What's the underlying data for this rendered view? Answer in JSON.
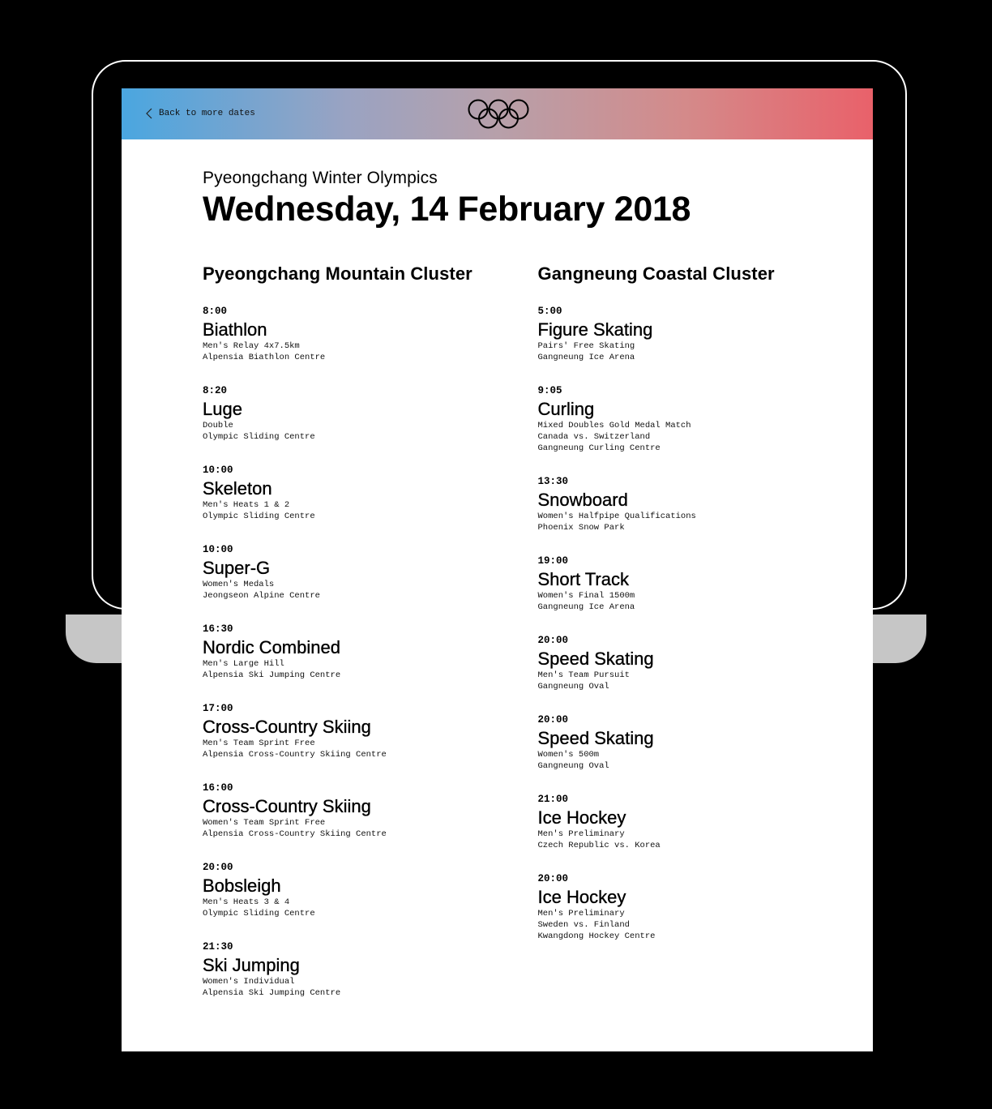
{
  "header": {
    "back_label": "Back to more dates",
    "logo": "olympic-rings-icon",
    "gradient_colors": [
      "#4aa6e0",
      "#e9616a"
    ]
  },
  "page": {
    "event_name": "Pyeongchang Winter Olympics",
    "date": "Wednesday, 14 February 2018"
  },
  "clusters": [
    {
      "name": "Pyeongchang Mountain Cluster",
      "events": [
        {
          "time": "8:00",
          "sport": "Biathlon",
          "details": [
            "Men's Relay 4x7.5km",
            "Alpensia Biathlon Centre"
          ]
        },
        {
          "time": "8:20",
          "sport": "Luge",
          "details": [
            "Double",
            "Olympic Sliding Centre"
          ]
        },
        {
          "time": "10:00",
          "sport": "Skeleton",
          "details": [
            "Men's Heats 1 & 2",
            "Olympic Sliding Centre"
          ]
        },
        {
          "time": "10:00",
          "sport": "Super-G",
          "details": [
            "Women's Medals",
            "Jeongseon Alpine Centre"
          ]
        },
        {
          "time": "16:30",
          "sport": "Nordic Combined",
          "details": [
            "Men's Large Hill",
            "Alpensia Ski Jumping Centre"
          ]
        },
        {
          "time": "17:00",
          "sport": "Cross-Country Skiing",
          "details": [
            "Men's Team Sprint Free",
            "Alpensia Cross-Country Skiing Centre"
          ]
        },
        {
          "time": "16:00",
          "sport": "Cross-Country Skiing",
          "details": [
            "Women's Team Sprint Free",
            "Alpensia Cross-Country Skiing Centre"
          ]
        },
        {
          "time": "20:00",
          "sport": "Bobsleigh",
          "details": [
            "Men's Heats 3 & 4",
            "Olympic Sliding Centre"
          ]
        },
        {
          "time": "21:30",
          "sport": "Ski Jumping",
          "details": [
            "Women's Individual",
            "Alpensia Ski Jumping Centre"
          ]
        }
      ]
    },
    {
      "name": "Gangneung Coastal Cluster",
      "events": [
        {
          "time": "5:00",
          "sport": "Figure Skating",
          "details": [
            "Pairs' Free Skating",
            "Gangneung Ice Arena"
          ]
        },
        {
          "time": "9:05",
          "sport": "Curling",
          "details": [
            "Mixed Doubles Gold Medal Match",
            "Canada vs. Switzerland",
            "Gangneung Curling Centre"
          ]
        },
        {
          "time": "13:30",
          "sport": "Snowboard",
          "details": [
            "Women's Halfpipe Qualifications",
            "Phoenix Snow Park"
          ]
        },
        {
          "time": "19:00",
          "sport": "Short Track",
          "details": [
            "Women's Final 1500m",
            "Gangneung Ice Arena"
          ]
        },
        {
          "time": "20:00",
          "sport": "Speed Skating",
          "details": [
            "Men's Team Pursuit",
            "Gangneung Oval"
          ]
        },
        {
          "time": "20:00",
          "sport": "Speed Skating",
          "details": [
            "Women's 500m",
            "Gangneung Oval"
          ]
        },
        {
          "time": "21:00",
          "sport": "Ice Hockey",
          "details": [
            "Men's Preliminary",
            "Czech Republic vs. Korea"
          ]
        },
        {
          "time": "20:00",
          "sport": "Ice Hockey",
          "details": [
            "Men's Preliminary",
            "Sweden vs. Finland",
            "Kwangdong Hockey Centre"
          ]
        }
      ]
    }
  ]
}
